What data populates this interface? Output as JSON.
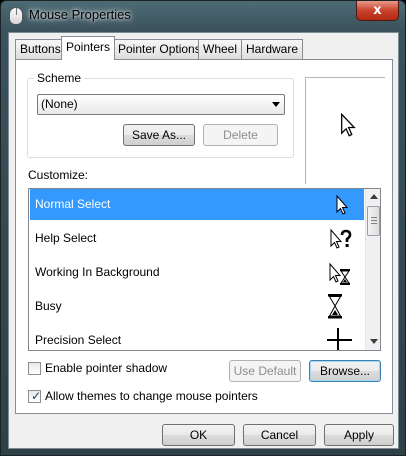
{
  "window": {
    "title": "Mouse Properties",
    "close_label": "x"
  },
  "tabs": [
    {
      "label": "Buttons",
      "active": false
    },
    {
      "label": "Pointers",
      "active": true
    },
    {
      "label": "Pointer Options",
      "active": false
    },
    {
      "label": "Wheel",
      "active": false
    },
    {
      "label": "Hardware",
      "active": false
    }
  ],
  "scheme": {
    "group_label": "Scheme",
    "selected": "(None)",
    "save_as_label": "Save As...",
    "delete_label": "Delete",
    "preview_icon": "arrow-cursor"
  },
  "customize": {
    "label": "Customize:",
    "items": [
      {
        "label": "Normal Select",
        "icon": "arrow-cursor",
        "selected": true
      },
      {
        "label": "Help Select",
        "icon": "help-cursor",
        "selected": false
      },
      {
        "label": "Working In Background",
        "icon": "working-cursor",
        "selected": false
      },
      {
        "label": "Busy",
        "icon": "hourglass-cursor",
        "selected": false
      },
      {
        "label": "Precision Select",
        "icon": "crosshair-cursor",
        "selected": false
      }
    ]
  },
  "options": {
    "shadow_label": "Enable pointer shadow",
    "shadow_checked": false,
    "use_default_label": "Use Default",
    "browse_label": "Browse...",
    "themes_label": "Allow themes to change mouse pointers",
    "themes_checked": true,
    "checkmark_glyph": "✓"
  },
  "footer": {
    "ok_label": "OK",
    "cancel_label": "Cancel",
    "apply_label": "Apply"
  },
  "colors": {
    "selection": "#3399ff",
    "close_button": "#c8432c"
  }
}
